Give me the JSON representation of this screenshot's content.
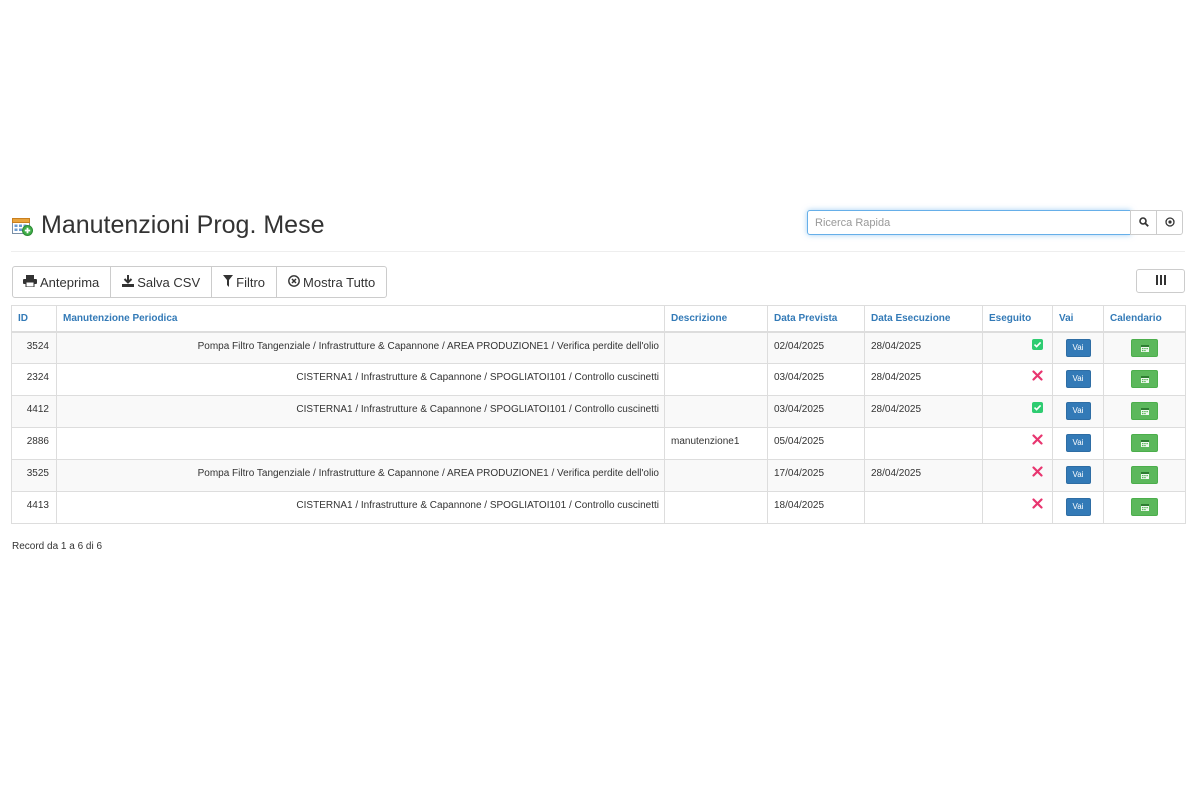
{
  "header": {
    "title": "Manutenzioni Prog. Mese",
    "title_icon": "calendar-add-icon",
    "search": {
      "placeholder": "Ricerca Rapida",
      "value": ""
    }
  },
  "toolbar": {
    "buttons": [
      {
        "label": "Anteprima",
        "icon": "print-icon"
      },
      {
        "label": "Salva CSV",
        "icon": "download-icon"
      },
      {
        "label": "Filtro",
        "icon": "filter-icon"
      },
      {
        "label": "Mostra Tutto",
        "icon": "close-circle-icon"
      }
    ],
    "columns_icon": "columns-icon"
  },
  "table": {
    "columns": [
      "ID",
      "Manutenzione Periodica",
      "Descrizione",
      "Data Prevista",
      "Data Esecuzione",
      "Eseguito",
      "Vai",
      "Calendario"
    ],
    "vai_label": "Vai",
    "rows": [
      {
        "id": "3524",
        "manutenzione": "Pompa Filtro Tangenziale / Infrastrutture & Capannone / AREA PRODUZIONE1 / Verifica perdite dell'olio",
        "descrizione": "",
        "data_prevista": "02/04/2025",
        "data_esecuzione": "28/04/2025",
        "eseguito": true
      },
      {
        "id": "2324",
        "manutenzione": "CISTERNA1 / Infrastrutture & Capannone / SPOGLIATOI101 / Controllo cuscinetti",
        "descrizione": "",
        "data_prevista": "03/04/2025",
        "data_esecuzione": "28/04/2025",
        "eseguito": false
      },
      {
        "id": "4412",
        "manutenzione": "CISTERNA1 / Infrastrutture & Capannone / SPOGLIATOI101 / Controllo cuscinetti",
        "descrizione": "",
        "data_prevista": "03/04/2025",
        "data_esecuzione": "28/04/2025",
        "eseguito": true
      },
      {
        "id": "2886",
        "manutenzione": "",
        "descrizione": "manutenzione1",
        "data_prevista": "05/04/2025",
        "data_esecuzione": "",
        "eseguito": false
      },
      {
        "id": "3525",
        "manutenzione": "Pompa Filtro Tangenziale / Infrastrutture & Capannone / AREA PRODUZIONE1 / Verifica perdite dell'olio",
        "descrizione": "",
        "data_prevista": "17/04/2025",
        "data_esecuzione": "28/04/2025",
        "eseguito": false
      },
      {
        "id": "4413",
        "manutenzione": "CISTERNA1 / Infrastrutture & Capannone / SPOGLIATOI101 / Controllo cuscinetti",
        "descrizione": "",
        "data_prevista": "18/04/2025",
        "data_esecuzione": "",
        "eseguito": false
      }
    ]
  },
  "footer": {
    "info": "Record da 1 a 6 di 6"
  },
  "colors": {
    "link": "#337ab7",
    "primary": "#337ab7",
    "success": "#5cb85c",
    "check_ok": "#2ecc71",
    "check_ko": "#e8356f"
  }
}
